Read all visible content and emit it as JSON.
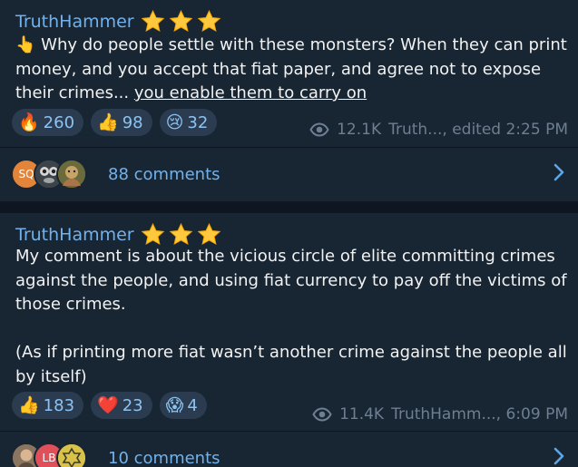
{
  "posts": [
    {
      "author": "TruthHammer",
      "author_badges": [
        "star-icon",
        "star-icon",
        "star-icon"
      ],
      "emoji": "👆",
      "text": " Why do people settle with these monsters? When they can print money, and you accept that fiat paper, and agree not to expose their crimes... ",
      "text_link": "you enable them to carry on",
      "reactions": [
        {
          "emoji": "🔥",
          "count": "260"
        },
        {
          "emoji": "👍",
          "count": "98"
        },
        {
          "emoji": "😢",
          "count": "32"
        }
      ],
      "views": "12.1K",
      "signature": "Truth..., edited 2:25 PM",
      "comments": {
        "label": "88 comments",
        "avatars": [
          {
            "initials": "SQ",
            "color": "#e3843b"
          },
          {
            "initials": "",
            "color": "#5f6870"
          },
          {
            "initials": "",
            "color": "#6f7a3a"
          }
        ]
      }
    },
    {
      "author": "TruthHammer",
      "author_badges": [
        "star-icon",
        "star-icon",
        "star-icon"
      ],
      "text": "My comment is about the vicious circle of elite committing crimes against the people, and using fiat currency to pay off the victims of those crimes.\n\n(As if printing more fiat wasn’t another crime against the people all by itself)",
      "reactions": [
        {
          "emoji": "👍",
          "count": "183"
        },
        {
          "emoji": "❤️",
          "count": "23"
        },
        {
          "emoji": "😱",
          "count": "4"
        }
      ],
      "views": "11.4K",
      "signature": "TruthHamm..., 6:09 PM",
      "comments": {
        "label": "10 comments",
        "avatars": [
          {
            "initials": "",
            "color": "#7a6a55"
          },
          {
            "initials": "LB",
            "color": "#e0505a"
          },
          {
            "initials": "",
            "color": "#d9c24a"
          }
        ]
      }
    }
  ],
  "colors": {
    "background": "#0e1621",
    "card": "#182533",
    "accent": "#72b2ec",
    "muted": "#6d7f91",
    "reaction_bg": "#2b3c51"
  }
}
